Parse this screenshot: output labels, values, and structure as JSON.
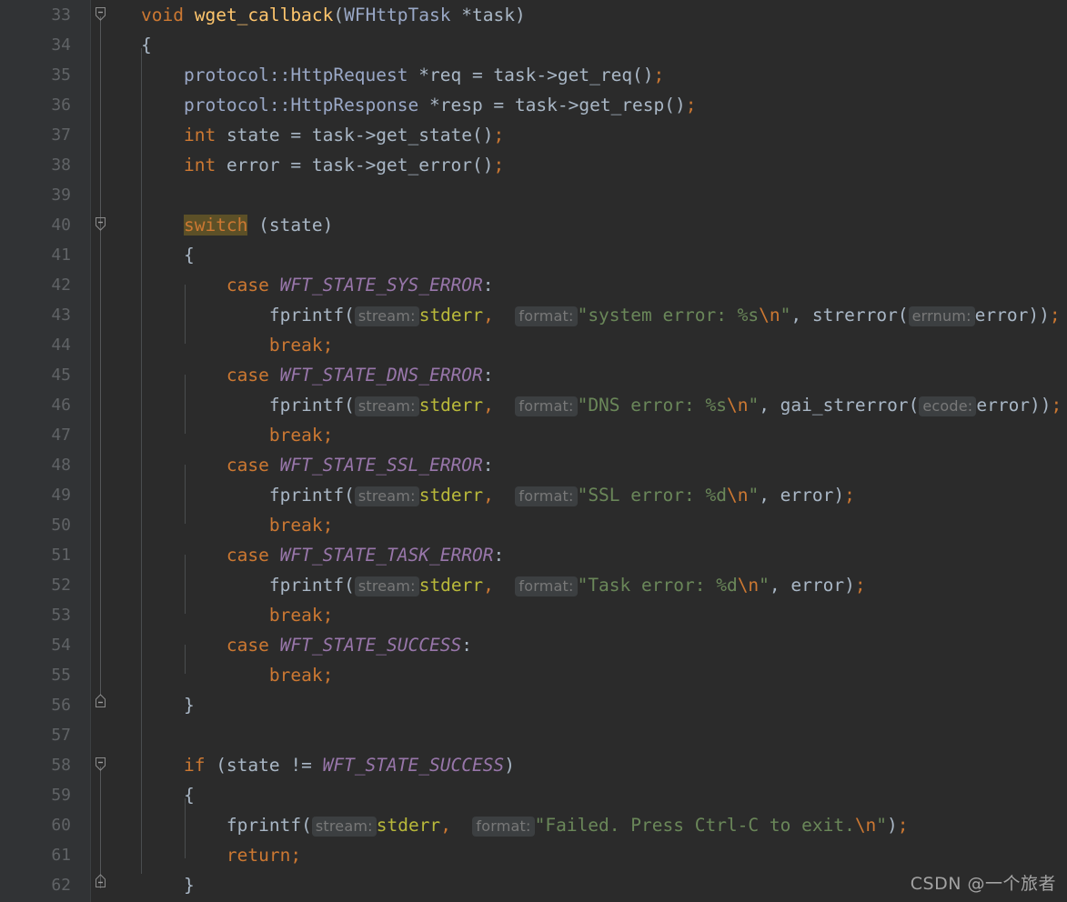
{
  "editor": {
    "theme": "Darcula",
    "background": "#2b2b2b",
    "gutter_background": "#313335",
    "language": "C++",
    "first_line": 33,
    "last_line": 62
  },
  "colors": {
    "keyword": "#cc7832",
    "string": "#6a8759",
    "constant": "#9876aa",
    "type": "#9aa8c7",
    "function_decl": "#ffc66d",
    "global_var": "#b9b93a",
    "plain_text": "#a9b7c6",
    "hint_text": "#787878",
    "hint_background": "#3c3f41",
    "keyword_highlight_background": "#5c5027",
    "line_number": "#606366",
    "indent_guide": "#4a4d4f"
  },
  "line_numbers": [
    33,
    34,
    35,
    36,
    37,
    38,
    39,
    40,
    41,
    42,
    43,
    44,
    45,
    46,
    47,
    48,
    49,
    50,
    51,
    52,
    53,
    54,
    55,
    56,
    57,
    58,
    59,
    60,
    61,
    62
  ],
  "fold_markers": [
    {
      "line": 33,
      "state": "expanded-open",
      "icon": "fold-collapse-icon"
    },
    {
      "line": 40,
      "state": "expanded-open",
      "icon": "fold-collapse-icon"
    },
    {
      "line": 56,
      "state": "expanded-close",
      "icon": "fold-end-icon"
    },
    {
      "line": 58,
      "state": "expanded-open",
      "icon": "fold-collapse-icon"
    },
    {
      "line": 62,
      "state": "expanded-close",
      "icon": "fold-end-icon"
    }
  ],
  "code_lines": [
    {
      "n": 33,
      "text": "void wget_callback(WFHttpTask *task)"
    },
    {
      "n": 34,
      "text": "{"
    },
    {
      "n": 35,
      "text": "    protocol::HttpRequest *req = task->get_req();"
    },
    {
      "n": 36,
      "text": "    protocol::HttpResponse *resp = task->get_resp();"
    },
    {
      "n": 37,
      "text": "    int state = task->get_state();"
    },
    {
      "n": 38,
      "text": "    int error = task->get_error();"
    },
    {
      "n": 39,
      "text": ""
    },
    {
      "n": 40,
      "text": "    switch (state)"
    },
    {
      "n": 41,
      "text": "    {"
    },
    {
      "n": 42,
      "text": "    case WFT_STATE_SYS_ERROR:"
    },
    {
      "n": 43,
      "text": "        fprintf(stderr, \"system error: %s\\n\", strerror(error));"
    },
    {
      "n": 44,
      "text": "        break;"
    },
    {
      "n": 45,
      "text": "    case WFT_STATE_DNS_ERROR:"
    },
    {
      "n": 46,
      "text": "        fprintf(stderr, \"DNS error: %s\\n\", gai_strerror(error));"
    },
    {
      "n": 47,
      "text": "        break;"
    },
    {
      "n": 48,
      "text": "    case WFT_STATE_SSL_ERROR:"
    },
    {
      "n": 49,
      "text": "        fprintf(stderr, \"SSL error: %d\\n\", error);"
    },
    {
      "n": 50,
      "text": "        break;"
    },
    {
      "n": 51,
      "text": "    case WFT_STATE_TASK_ERROR:"
    },
    {
      "n": 52,
      "text": "        fprintf(stderr, \"Task error: %d\\n\", error);"
    },
    {
      "n": 53,
      "text": "        break;"
    },
    {
      "n": 54,
      "text": "    case WFT_STATE_SUCCESS:"
    },
    {
      "n": 55,
      "text": "        break;"
    },
    {
      "n": 56,
      "text": "    }"
    },
    {
      "n": 57,
      "text": ""
    },
    {
      "n": 58,
      "text": "    if (state != WFT_STATE_SUCCESS)"
    },
    {
      "n": 59,
      "text": "    {"
    },
    {
      "n": 60,
      "text": "        fprintf(stderr, \"Failed. Press Ctrl-C to exit.\\n\");"
    },
    {
      "n": 61,
      "text": "        return;"
    },
    {
      "n": 62,
      "text": "    }"
    }
  ],
  "tokens": {
    "l33": {
      "kw_void": "void",
      "fn_name": "wget_callback",
      "p_open": "(",
      "type": "WFHttpTask",
      "star_task": " *task",
      "p_close": ")"
    },
    "l34": {
      "brace": "{"
    },
    "l35": {
      "ns_type": "protocol::HttpRequest",
      "rest": " *req = task->get_req()",
      "semi": ";"
    },
    "l36": {
      "ns_type": "protocol::HttpResponse",
      "rest": " *resp = task->get_resp()",
      "semi": ";"
    },
    "l37": {
      "kw_int": "int",
      "rest": " state = task->get_state()",
      "semi": ";"
    },
    "l38": {
      "kw_int": "int",
      "rest": " error = task->get_error()",
      "semi": ";"
    },
    "l40": {
      "kw_switch": "switch",
      "rest": " (state)"
    },
    "l41": {
      "brace": "{"
    },
    "l42": {
      "kw_case": "case",
      "constant": "WFT_STATE_SYS_ERROR",
      "colon": ":"
    },
    "l43": {
      "fn": "fprintf",
      "p_open": "(",
      "hint_stream": "stream:",
      "global": "stderr",
      "comma": ",",
      "hint_format": "format:",
      "str_a": "\"system error: %s",
      "esc": "\\n",
      "str_b": "\"",
      "mid": ", strerror",
      "p_open2": "(",
      "hint_errnum": "errnum:",
      "arg": "error",
      "p_close": "))",
      "semi": ";"
    },
    "l44": {
      "kw_break": "break",
      "semi": ";"
    },
    "l45": {
      "kw_case": "case",
      "constant": "WFT_STATE_DNS_ERROR",
      "colon": ":"
    },
    "l46": {
      "fn": "fprintf",
      "p_open": "(",
      "hint_stream": "stream:",
      "global": "stderr",
      "comma": ",",
      "hint_format": "format:",
      "str_a": "\"DNS error: %s",
      "esc": "\\n",
      "str_b": "\"",
      "mid": ", gai_strerror",
      "p_open2": "(",
      "hint_ecode": "ecode:",
      "arg": "error",
      "p_close": "))",
      "semi": ";"
    },
    "l47": {
      "kw_break": "break",
      "semi": ";"
    },
    "l48": {
      "kw_case": "case",
      "constant": "WFT_STATE_SSL_ERROR",
      "colon": ":"
    },
    "l49": {
      "fn": "fprintf",
      "p_open": "(",
      "hint_stream": "stream:",
      "global": "stderr",
      "comma": ",",
      "hint_format": "format:",
      "str_a": "\"SSL error: %d",
      "esc": "\\n",
      "str_b": "\"",
      "tail": ", error)",
      "semi": ";"
    },
    "l50": {
      "kw_break": "break",
      "semi": ";"
    },
    "l51": {
      "kw_case": "case",
      "constant": "WFT_STATE_TASK_ERROR",
      "colon": ":"
    },
    "l52": {
      "fn": "fprintf",
      "p_open": "(",
      "hint_stream": "stream:",
      "global": "stderr",
      "comma": ",",
      "hint_format": "format:",
      "str_a": "\"Task error: %d",
      "esc": "\\n",
      "str_b": "\"",
      "tail": ", error)",
      "semi": ";"
    },
    "l53": {
      "kw_break": "break",
      "semi": ";"
    },
    "l54": {
      "kw_case": "case",
      "constant": "WFT_STATE_SUCCESS",
      "colon": ":"
    },
    "l55": {
      "kw_break": "break",
      "semi": ";"
    },
    "l56": {
      "brace": "}"
    },
    "l58": {
      "kw_if": "if",
      "cond_a": " (state != ",
      "constant": "WFT_STATE_SUCCESS",
      "cond_b": ")"
    },
    "l59": {
      "brace": "{"
    },
    "l60": {
      "fn": "fprintf",
      "p_open": "(",
      "hint_stream": "stream:",
      "global": "stderr",
      "comma": ",",
      "hint_format": "format:",
      "str_a": "\"Failed. Press Ctrl-C to exit.",
      "esc": "\\n",
      "str_b": "\"",
      "p_close": ")",
      "semi": ";"
    },
    "l61": {
      "kw_return": "return",
      "semi": ";"
    },
    "l62": {
      "brace": "}"
    }
  },
  "watermark": {
    "text": "CSDN @一个旅者"
  }
}
